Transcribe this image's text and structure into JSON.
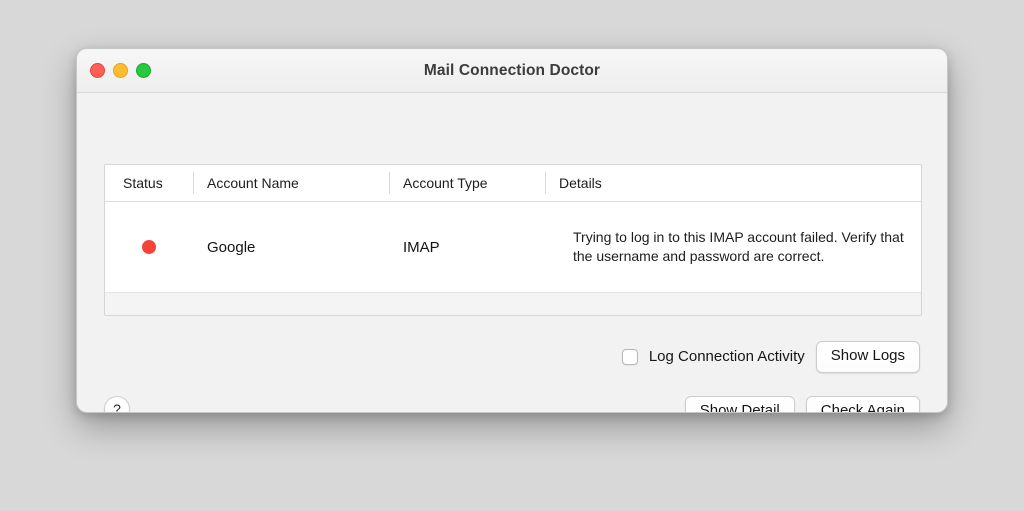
{
  "window": {
    "title": "Mail Connection Doctor",
    "traffic_lights": [
      {
        "name": "close",
        "color": "#ff5f57"
      },
      {
        "name": "minimize",
        "color": "#febc2e"
      },
      {
        "name": "zoom",
        "color": "#28c840"
      }
    ]
  },
  "table": {
    "columns": [
      "Status",
      "Account Name",
      "Account Type",
      "Details"
    ],
    "rows": [
      {
        "status_color": "#f4433a",
        "status_label": "error",
        "account_name": "Google",
        "account_type": "IMAP",
        "details": "Trying to log in to this IMAP account failed. Verify that the username and password are correct."
      }
    ]
  },
  "log_row": {
    "checkbox_label": "Log Connection Activity",
    "checkbox_checked": false,
    "show_logs_label": "Show Logs"
  },
  "footer": {
    "help_label": "?",
    "show_detail_label": "Show Detail",
    "check_again_label": "Check Again"
  }
}
